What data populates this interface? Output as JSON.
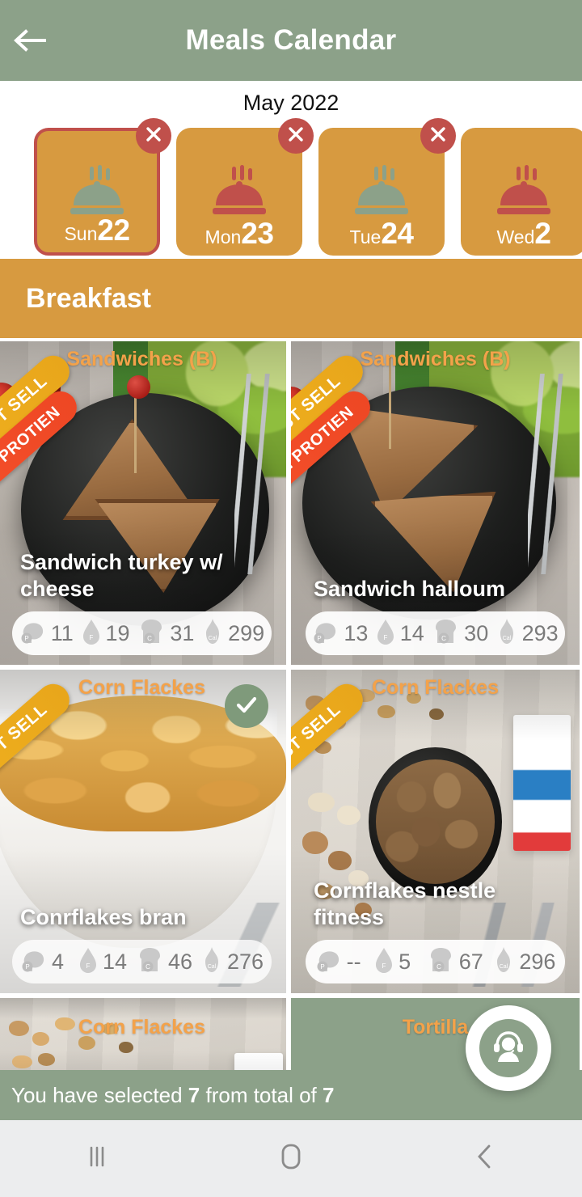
{
  "appbar": {
    "title": "Meals Calendar",
    "back_icon": "arrow-left-icon"
  },
  "date_strip": {
    "month": "May 2022",
    "dates": [
      {
        "dow": "Sun",
        "day": "22",
        "selected": true,
        "cloche_color": "#8CA189",
        "has_close": true
      },
      {
        "dow": "Mon",
        "day": "23",
        "selected": false,
        "cloche_color": "#C0504B",
        "has_close": true
      },
      {
        "dow": "Tue",
        "day": "24",
        "selected": false,
        "cloche_color": "#8CA189",
        "has_close": true
      },
      {
        "dow": "Wed",
        "day": "2",
        "selected": false,
        "cloche_color": "#C0504B",
        "has_close": false
      }
    ],
    "close_icon": "close-icon",
    "card_bg": "#D79A40",
    "selected_border": "#C0504B"
  },
  "meal_section": {
    "title": "Breakfast",
    "bg": "#D79A40"
  },
  "nutrition_legend": {
    "protein": "P",
    "fat": "F",
    "carbs": "C",
    "calories": "Cal"
  },
  "meals": [
    {
      "category": "Sandwiches (B)",
      "name": "Sandwich turkey w/ cheese",
      "badges": [
        "BEST SELL",
        "HIGH PROTIEN"
      ],
      "selected": false,
      "nutrition": {
        "protein": "11",
        "fat": "19",
        "carbs": "31",
        "calories": "299"
      }
    },
    {
      "category": "Sandwiches (B)",
      "name": "Sandwich halloum",
      "badges": [
        "BEST SELL",
        "HIGH PROTIEN"
      ],
      "selected": false,
      "nutrition": {
        "protein": "13",
        "fat": "14",
        "carbs": "30",
        "calories": "293"
      }
    },
    {
      "category": "Corn Flackes",
      "name": "Conrflakes bran",
      "badges": [
        "BEST SELL"
      ],
      "selected": true,
      "nutrition": {
        "protein": "4",
        "fat": "14",
        "carbs": "46",
        "calories": "276"
      }
    },
    {
      "category": "Corn Flackes",
      "name": "Cornflakes nestle fitness",
      "badges": [
        "BEST SELL"
      ],
      "selected": false,
      "nutrition": {
        "protein": "--",
        "fat": "5",
        "carbs": "67",
        "calories": "296"
      }
    },
    {
      "category": "Corn Flackes",
      "name": "",
      "badges": [],
      "selected": false,
      "nutrition": {
        "protein": "",
        "fat": "",
        "carbs": "",
        "calories": ""
      }
    },
    {
      "category": "Tortilla",
      "name": "",
      "badges": [],
      "selected": false,
      "nutrition": {
        "protein": "",
        "fat": "",
        "carbs": "",
        "calories": ""
      }
    }
  ],
  "footer": {
    "prefix": "You have selected",
    "selected_count": "7",
    "middle": "from total of",
    "total_count": "7",
    "bg": "#8CA189"
  },
  "fab": {
    "icon": "support-agent-icon"
  },
  "sysnav": {
    "recents_icon": "recents-icon",
    "home_icon": "home-icon",
    "back_icon": "back-chevron-icon"
  },
  "colors": {
    "brand_green": "#8CA189",
    "brand_orange": "#D79A40",
    "accent_red": "#C0504B",
    "category_orange": "#F3A24A",
    "badge_best": "#F0B01E",
    "badge_protein": "#F4502B"
  }
}
